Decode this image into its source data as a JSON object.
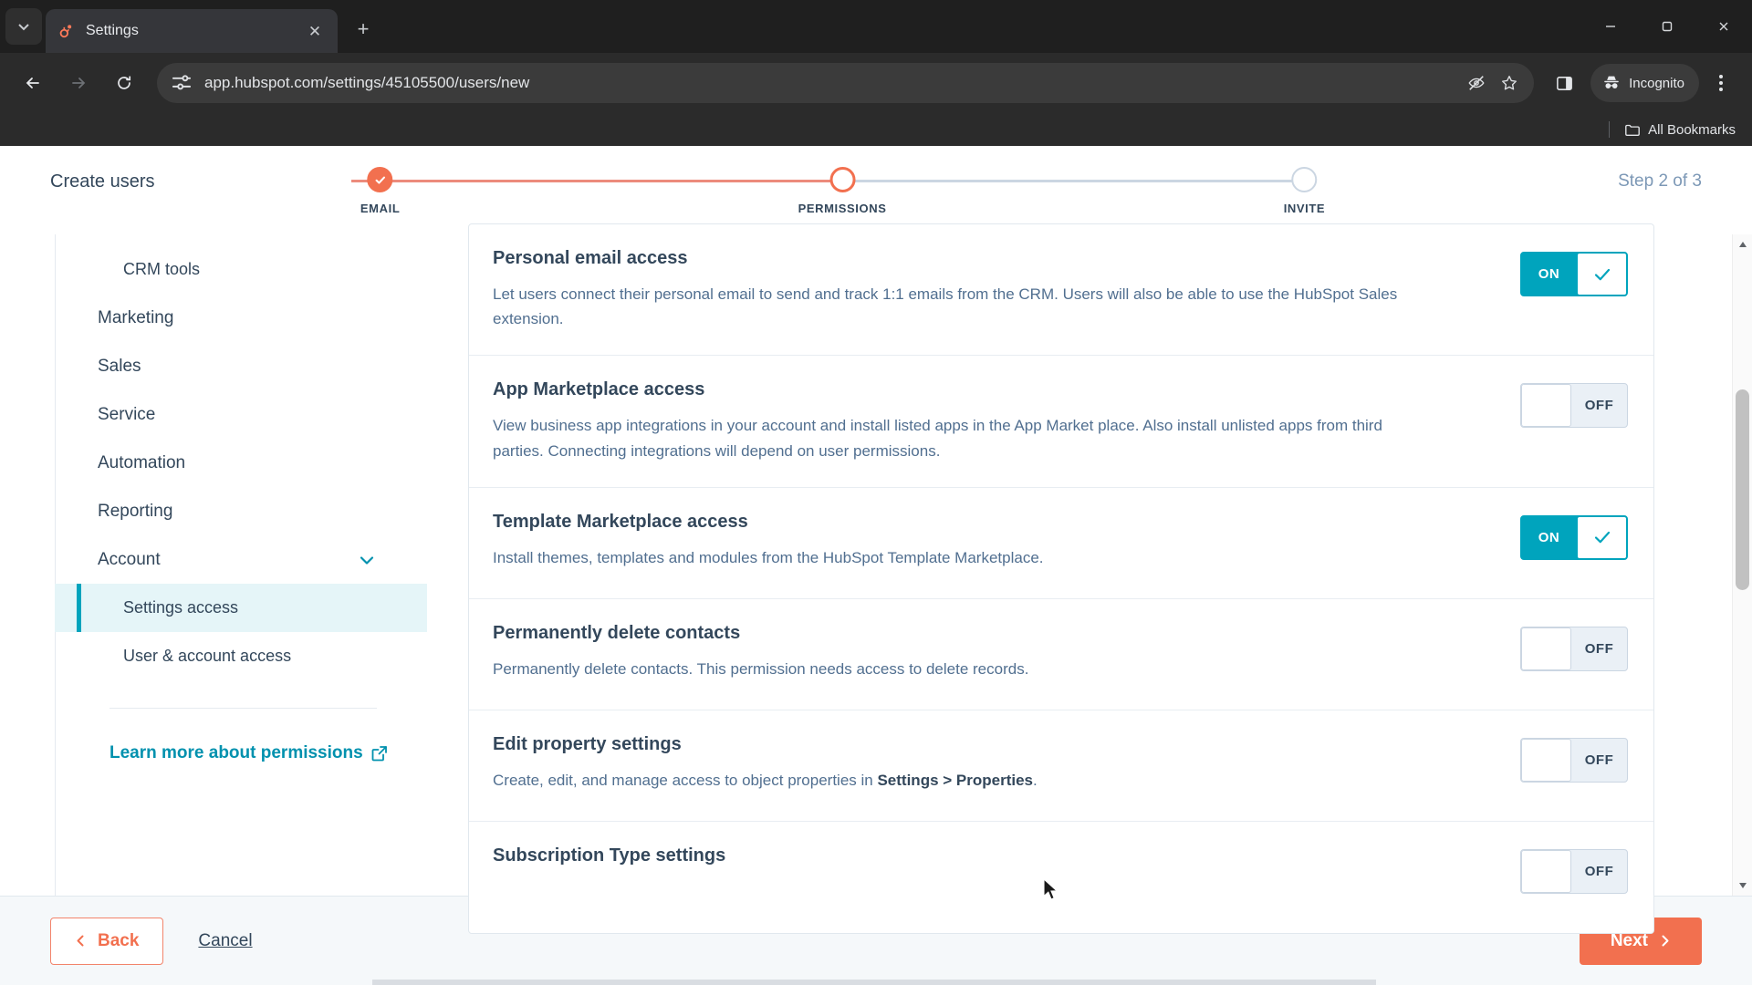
{
  "browser": {
    "tab": {
      "title": "Settings",
      "favicon": "hubspot-sprocket-icon",
      "close_label": "✕"
    },
    "new_tab_label": "+",
    "window_controls": {
      "minimize": "minimize-icon",
      "maximize": "maximize-icon",
      "close": "close-icon"
    },
    "url": "app.hubspot.com/settings/45105500/users/new",
    "profile_label": "Incognito",
    "bookmarks_label": "All Bookmarks",
    "icons": {
      "back": "back-arrow-icon",
      "forward": "forward-arrow-icon",
      "reload": "reload-icon",
      "site_info": "site-settings-icon",
      "tracking_protection": "eye-slash-icon",
      "bookmark": "star-icon",
      "side_panel": "side-panel-icon",
      "menu": "three-dot-menu-icon",
      "folder": "folder-icon",
      "tab_search": "chevron-down-icon"
    }
  },
  "header": {
    "title": "Create users",
    "step_counter": "Step 2 of 3",
    "steps": [
      {
        "label": "EMAIL",
        "state": "done"
      },
      {
        "label": "PERMISSIONS",
        "state": "current"
      },
      {
        "label": "INVITE",
        "state": "todo"
      }
    ],
    "progress_percent": 51
  },
  "sidebar": {
    "items": [
      {
        "label": "CRM tools",
        "level": "sub",
        "active": false,
        "expandable": false
      },
      {
        "label": "Marketing",
        "level": "top",
        "active": false,
        "expandable": false
      },
      {
        "label": "Sales",
        "level": "top",
        "active": false,
        "expandable": false
      },
      {
        "label": "Service",
        "level": "top",
        "active": false,
        "expandable": false
      },
      {
        "label": "Automation",
        "level": "top",
        "active": false,
        "expandable": false
      },
      {
        "label": "Reporting",
        "level": "top",
        "active": false,
        "expandable": false
      },
      {
        "label": "Account",
        "level": "top",
        "active": false,
        "expandable": true
      },
      {
        "label": "Settings access",
        "level": "sub",
        "active": true,
        "expandable": false
      },
      {
        "label": "User & account access",
        "level": "sub",
        "active": false,
        "expandable": false
      }
    ],
    "learn_more": {
      "label": "Learn more about permissions",
      "icon": "external-link-icon"
    }
  },
  "main": {
    "permissions": [
      {
        "title": "Personal email access",
        "description": "Let users connect their personal email to send and track 1:1 emails from the CRM. Users will also be able to use the HubSpot Sales extension.",
        "toggle_state": "ON"
      },
      {
        "title": "App Marketplace access",
        "description": "View business app integrations in your account and install listed apps in the App Market place. Also install unlisted apps from third parties. Connecting integrations will depend on user permissions.",
        "toggle_state": "OFF"
      },
      {
        "title": "Template Marketplace access",
        "description": "Install themes, templates and modules from the HubSpot Template Marketplace.",
        "toggle_state": "ON"
      },
      {
        "title": "Permanently delete contacts",
        "description": "Permanently delete contacts. This permission needs access to delete records.",
        "toggle_state": "OFF"
      },
      {
        "title": "Edit property settings",
        "description_pre": "Create, edit, and manage access to object properties in ",
        "description_bold": "Settings > Properties",
        "description_post": ".",
        "toggle_state": "OFF"
      },
      {
        "title": "Subscription Type settings",
        "description": "",
        "toggle_state": "OFF"
      }
    ]
  },
  "footer": {
    "back_label": "Back",
    "cancel_label": "Cancel",
    "next_label": "Next"
  },
  "colors": {
    "accent_orange": "#f2704f",
    "accent_teal": "#00a4bd",
    "text_dark": "#33475b",
    "text_muted": "#516f90"
  }
}
